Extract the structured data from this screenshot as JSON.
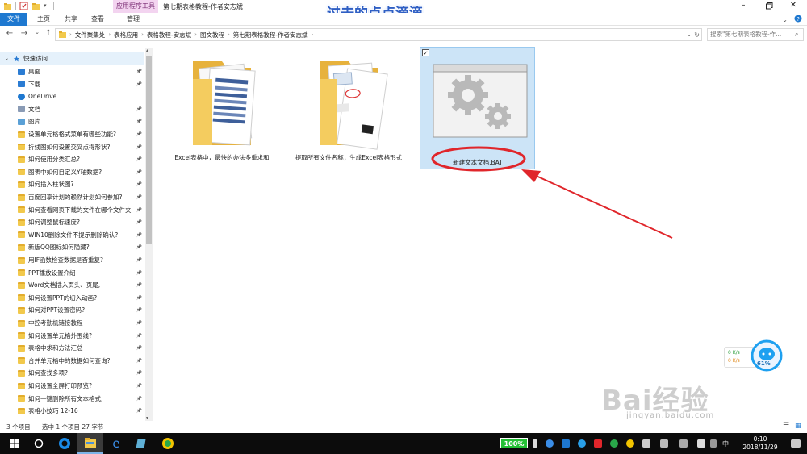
{
  "titlebar": {
    "app_tools_tab": "应用程序工具",
    "window_title": "第七期表格教程-作者安志斌",
    "overlay_title": "过去的点点滴滴"
  },
  "ribbon": {
    "tabs": [
      {
        "label": "文件"
      },
      {
        "label": "主页"
      },
      {
        "label": "共享"
      },
      {
        "label": "查看"
      },
      {
        "label": "管理"
      }
    ]
  },
  "address": {
    "crumbs": [
      "文件聚集处",
      "表格应用",
      "表格教程-安志斌",
      "图文教程",
      "第七期表格教程-作者安志斌"
    ],
    "search_placeholder": "搜索\"第七期表格教程-作..."
  },
  "sidebar": {
    "quick_access": "快速访问",
    "items": [
      {
        "label": "桌面",
        "icon": "desktop-icon"
      },
      {
        "label": "下载",
        "icon": "download-icon"
      },
      {
        "label": "OneDrive",
        "icon": "cloud-icon"
      },
      {
        "label": "文档",
        "icon": "document-icon"
      },
      {
        "label": "图片",
        "icon": "picture-icon"
      },
      {
        "label": "设置单元格格式菜单有哪些功能?",
        "icon": "folder-icon"
      },
      {
        "label": "折线图如何设置交叉点得形状?",
        "icon": "folder-icon"
      },
      {
        "label": "如何使用分类汇总?",
        "icon": "folder-icon"
      },
      {
        "label": "图表中如何自定义Y轴数据?",
        "icon": "folder-icon"
      },
      {
        "label": "如何插入柱状图?",
        "icon": "folder-icon"
      },
      {
        "label": "百度回享计划的赖然计划如何参加?",
        "icon": "folder-icon"
      },
      {
        "label": "如何查看网页下载的文件在哪个文件夹",
        "icon": "folder-icon"
      },
      {
        "label": "如何调整鼠标速度?",
        "icon": "folder-icon"
      },
      {
        "label": "WIN10删除文件不提示删除确认?",
        "icon": "folder-icon"
      },
      {
        "label": "新版QQ图标如何隐藏?",
        "icon": "folder-icon"
      },
      {
        "label": "用IF函数检查数据是否重复?",
        "icon": "folder-icon"
      },
      {
        "label": "PPT播放设置介绍",
        "icon": "folder-icon"
      },
      {
        "label": "Word文档插入页头、页尾,",
        "icon": "folder-icon"
      },
      {
        "label": "如何设置PPT的切入动画?",
        "icon": "folder-icon"
      },
      {
        "label": "如何对PPT设置密码?",
        "icon": "folder-icon"
      },
      {
        "label": "中控考勤机链接教程",
        "icon": "folder-icon"
      },
      {
        "label": "如何设置单元格外围线?",
        "icon": "folder-icon"
      },
      {
        "label": "表格中求和方法汇总",
        "icon": "folder-icon"
      },
      {
        "label": "合并单元格中的数据如何查询?",
        "icon": "folder-icon"
      },
      {
        "label": "如何查找多项?",
        "icon": "folder-icon"
      },
      {
        "label": "如何设置全屏打印预览?",
        "icon": "folder-icon"
      },
      {
        "label": "如何一键删除所有文本格式;",
        "icon": "folder-icon"
      },
      {
        "label": "表格小技巧 12-16",
        "icon": "folder-icon"
      }
    ]
  },
  "files": [
    {
      "label": "Excel表格中，最快的办法多重求和",
      "icon": "folder-icon"
    },
    {
      "label": "提取所有文件名称，生成Excel表格形式",
      "icon": "folder-icon"
    },
    {
      "label": "新建文本文档.BAT",
      "icon": "batch-file-gear-icon"
    }
  ],
  "status": {
    "count": "3 个项目",
    "selection": "选中 1 个项目  27 字节"
  },
  "net_widget": {
    "up": "0  K/s",
    "down": "0  K/s",
    "percent": "61%"
  },
  "watermark": {
    "brand": "Bai经验",
    "url": "jingyan.baidu.com"
  },
  "taskbar": {
    "battery": "100%",
    "ime": "中",
    "time": "0:10",
    "date": "2018/11/29"
  },
  "colors": {
    "accent": "#1e78d0",
    "selection": "#cce4f7",
    "annotation_red": "#e0262b",
    "folder": "#f2c94c"
  }
}
